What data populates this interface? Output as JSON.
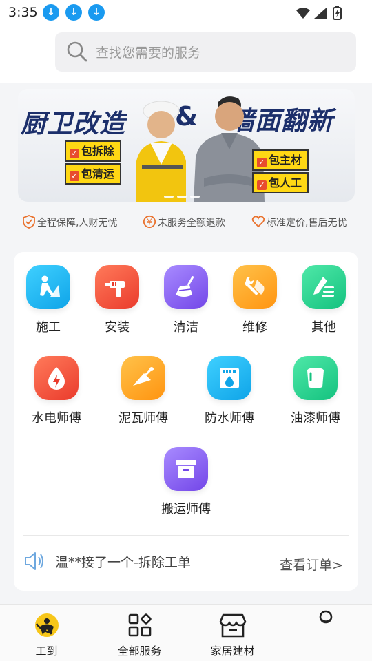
{
  "status_bar": {
    "time": "3:35"
  },
  "search": {
    "placeholder": "查找您需要的服务"
  },
  "banner": {
    "title_left": "厨卫改造",
    "ampersand": "&",
    "title_right": "墙面翻新",
    "tags_left": [
      "包拆除",
      "包清运"
    ],
    "tags_right": [
      "包主材",
      "包人工"
    ],
    "accent_color": "#ffd814",
    "title_color": "#1c2f6b"
  },
  "guarantees": [
    {
      "icon": "shield-check-icon",
      "text": "全程保障,人财无忧"
    },
    {
      "icon": "yen-circle-icon",
      "text": "未服务全额退款"
    },
    {
      "icon": "heart-icon",
      "text": "标准定价,售后无忧"
    }
  ],
  "categories": {
    "row1": [
      {
        "label": "施工",
        "icon": "construction-worker-icon",
        "color": "#1fb7f0"
      },
      {
        "label": "安装",
        "icon": "drill-icon",
        "color": "#f0503c"
      },
      {
        "label": "清洁",
        "icon": "broom-icon",
        "color": "#8a5cf0"
      },
      {
        "label": "维修",
        "icon": "wrench-icon",
        "color": "#ffa21f"
      },
      {
        "label": "其他",
        "icon": "edit-list-icon",
        "color": "#21cf8e"
      }
    ],
    "row2": [
      {
        "label": "水电师傅",
        "icon": "lightning-drop-icon",
        "color": "#f0503c"
      },
      {
        "label": "泥瓦师傅",
        "icon": "trowel-icon",
        "color": "#ffa21f"
      },
      {
        "label": "防水师傅",
        "icon": "water-panel-icon",
        "color": "#1fb7f0"
      },
      {
        "label": "油漆师傅",
        "icon": "paint-bucket-icon",
        "color": "#21cf8e"
      }
    ],
    "row3": [
      {
        "label": "搬运师傅",
        "icon": "archive-box-icon",
        "color": "#8a5cf0"
      }
    ]
  },
  "notice": {
    "text": "温**接了一个-拆除工单",
    "link": "查看订单>"
  },
  "tabbar": [
    {
      "label": "工到",
      "icon": "app-logo-icon",
      "active": true
    },
    {
      "label": "全部服务",
      "icon": "grid-apps-icon"
    },
    {
      "label": "家居建材",
      "icon": "store-icon"
    },
    {
      "label": "",
      "icon": "profile-icon"
    }
  ]
}
